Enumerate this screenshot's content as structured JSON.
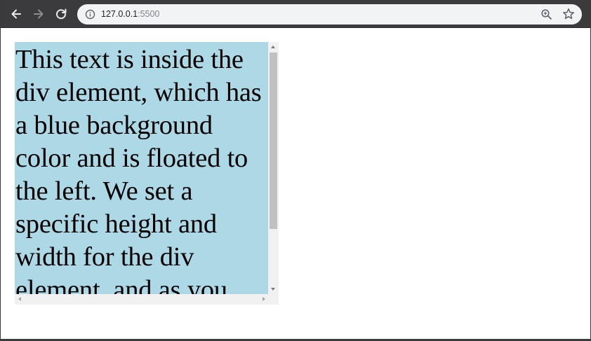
{
  "browser": {
    "url_host": "127.0.0.1",
    "url_port": ":5500",
    "icons": {
      "back": "back-arrow-icon",
      "forward": "forward-arrow-icon",
      "reload": "reload-icon",
      "site_info": "info-icon",
      "zoom": "zoom-icon",
      "bookmark": "star-icon"
    }
  },
  "page": {
    "box_text": "This text is inside the div element, which has a blue background color and is floated to the left. We set a specific height and width for the div element, and as you",
    "box_background": "#add8e6"
  }
}
